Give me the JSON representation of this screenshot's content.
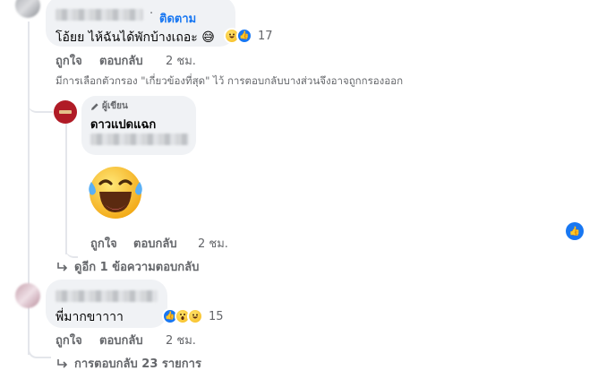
{
  "comment1": {
    "follow_label": "ติดตาม",
    "text": "โอ้ยย ไห้ฉันได้พักบ้างเถอะ 😅",
    "reaction_count": "17",
    "like_label": "ถูกใจ",
    "reply_label": "ตอบกลับ",
    "time": "2 ชม.",
    "filter_notice": "มีการเลือกตัวกรอง \"เกี่ยวข้องที่สุด\" ไว้ การตอบกลับบางส่วนจึงอาจถูกกรองออก"
  },
  "reply1": {
    "author_badge": "ผู้เขียน",
    "author_name": "ดาวแปดแฉก",
    "like_label": "ถูกใจ",
    "reply_label": "ตอบกลับ",
    "time": "2 ชม."
  },
  "more_replies": "ดูอีก 1 ข้อความตอบกลับ",
  "comment2": {
    "text": "พี่มากขาาาา",
    "reaction_count": "15",
    "like_label": "ถูกใจ",
    "reply_label": "ตอบกลับ",
    "time": "2 ชม."
  },
  "replies_count_label": "การตอบกลับ 23 รายการ",
  "icons": {
    "like": "like-icon",
    "laugh": "laugh-emoji-icon",
    "wow": "wow-emoji-icon",
    "reply_arrow": "reply-arrow-icon",
    "pencil": "pencil-icon"
  },
  "colors": {
    "accent": "#1877f2",
    "secondary_text": "#65676b",
    "bubble": "#f0f2f5",
    "emoji_yellow": "#f6b91c"
  }
}
